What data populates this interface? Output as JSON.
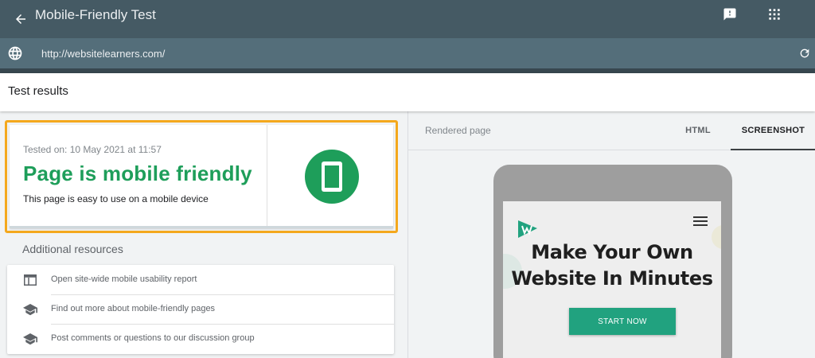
{
  "app": {
    "title": "Mobile-Friendly Test"
  },
  "url": {
    "value": "http://websitelearners.com/"
  },
  "results": {
    "title": "Test results"
  },
  "result_card": {
    "tested_on": "Tested on: 10 May 2021 at 11:57",
    "verdict": "Page is mobile friendly",
    "description": "This page is easy to use on a mobile device"
  },
  "additional": {
    "title": "Additional resources",
    "items": [
      {
        "label": "Open site-wide mobile usability report",
        "icon": "report-icon"
      },
      {
        "label": "Find out more about mobile-friendly pages",
        "icon": "school-icon"
      },
      {
        "label": "Post comments or questions to our discussion group",
        "icon": "school-icon"
      }
    ]
  },
  "rendered": {
    "label": "Rendered page",
    "tabs": [
      {
        "label": "HTML",
        "active": false
      },
      {
        "label": "SCREENSHOT",
        "active": true
      }
    ],
    "preview": {
      "hero_line1": "Make Your Own",
      "hero_line2": "Website In Minutes",
      "cta": "START NOW"
    }
  },
  "colors": {
    "topbar": "#455a64",
    "urlbar": "#546e7a",
    "success": "#1e9e5a",
    "highlight": "#f4a81d",
    "cta": "#21a27f"
  }
}
